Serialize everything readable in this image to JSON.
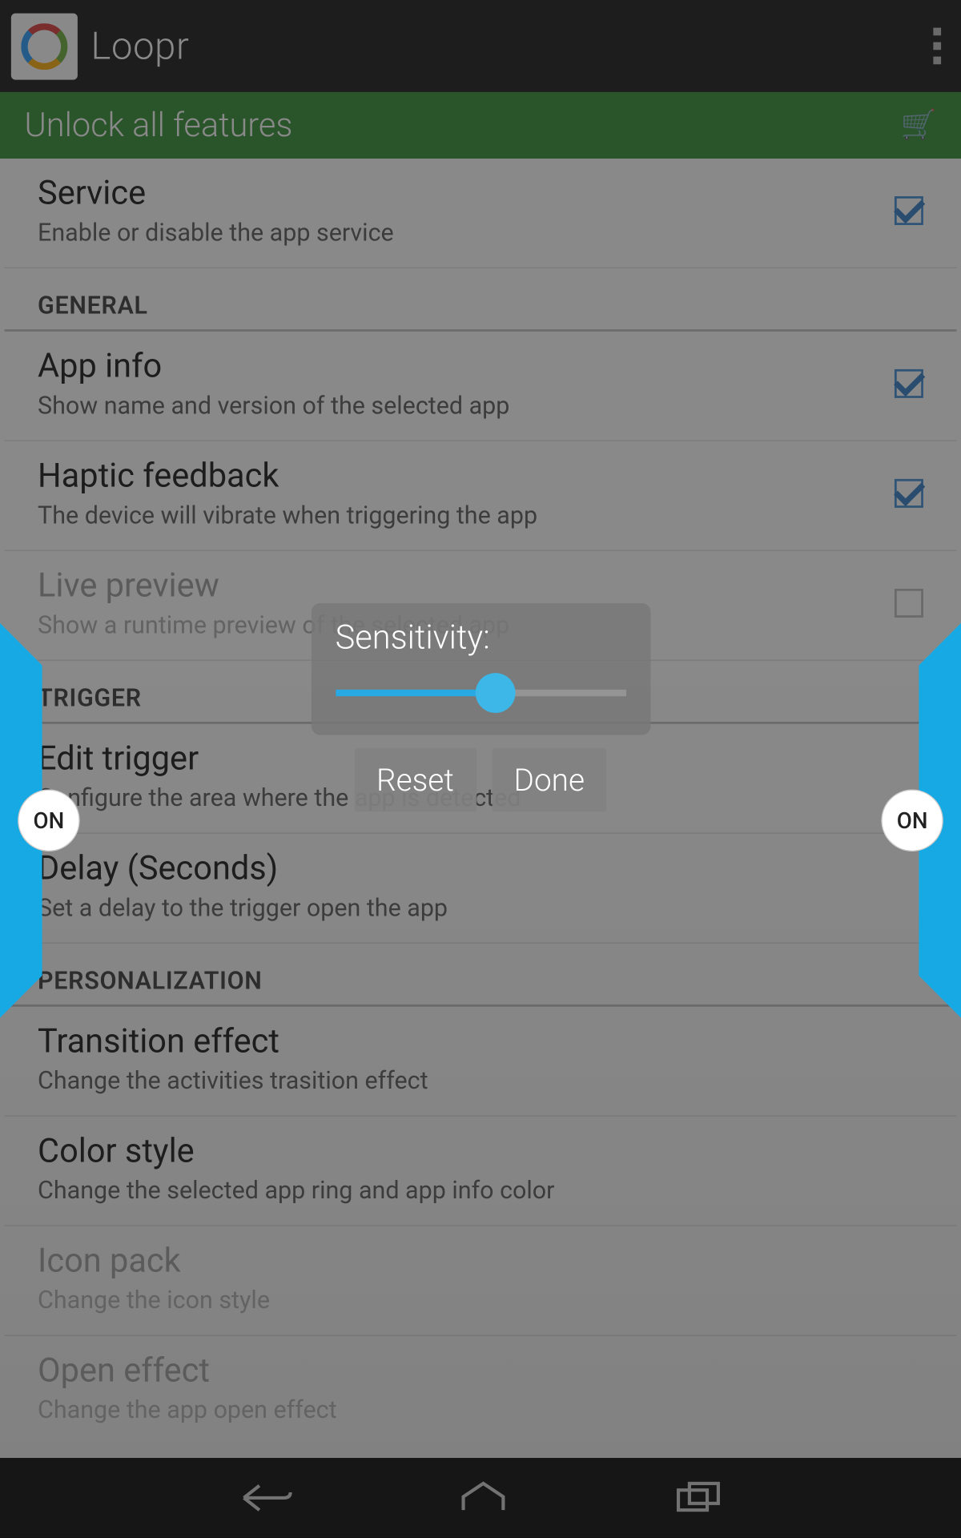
{
  "actionbar": {
    "title": "Loopr"
  },
  "promo": {
    "text": "Unlock all features",
    "icon": "cart-icon"
  },
  "sections": {
    "general": "GENERAL",
    "trigger": "TRIGGER",
    "personalization": "PERSONALIZATION"
  },
  "items": {
    "service": {
      "title": "Service",
      "subtitle": "Enable or disable the app service",
      "checked": true
    },
    "appinfo": {
      "title": "App info",
      "subtitle": "Show name and version of the selected app",
      "checked": true
    },
    "haptic": {
      "title": "Haptic feedback",
      "subtitle": "The device will vibrate when triggering the app",
      "checked": true
    },
    "livepreview": {
      "title": "Live preview",
      "subtitle": "Show a runtime preview of the selected app",
      "checked": false,
      "disabled": true
    },
    "edittrigger": {
      "title": "Edit trigger",
      "subtitle": "Configure the area where the app is detected"
    },
    "delay": {
      "title": "Delay (Seconds)",
      "subtitle": "Set a delay to the trigger open the app"
    },
    "transition": {
      "title": "Transition effect",
      "subtitle": "Change the activities trasition effect"
    },
    "colorstyle": {
      "title": "Color style",
      "subtitle": "Change the selected app ring and app info color"
    },
    "iconpack": {
      "title": "Icon pack",
      "subtitle": "Change the icon style",
      "disabled": true
    },
    "openeffect": {
      "title": "Open effect",
      "subtitle": "Change the app open effect",
      "disabled": true
    }
  },
  "handles": {
    "left": "ON",
    "right": "ON"
  },
  "dialog": {
    "title": "Sensitivity:",
    "reset_label": "Reset",
    "done_label": "Done",
    "slider_percent": 55
  }
}
